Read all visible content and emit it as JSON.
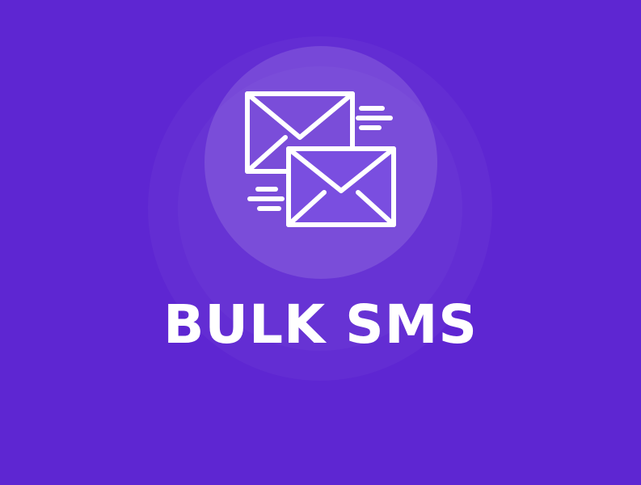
{
  "banner": {
    "title": "BULK SMS",
    "background_color": "#5e26d2",
    "icon": "mail-envelopes-icon",
    "icon_color": "#ffffff"
  }
}
